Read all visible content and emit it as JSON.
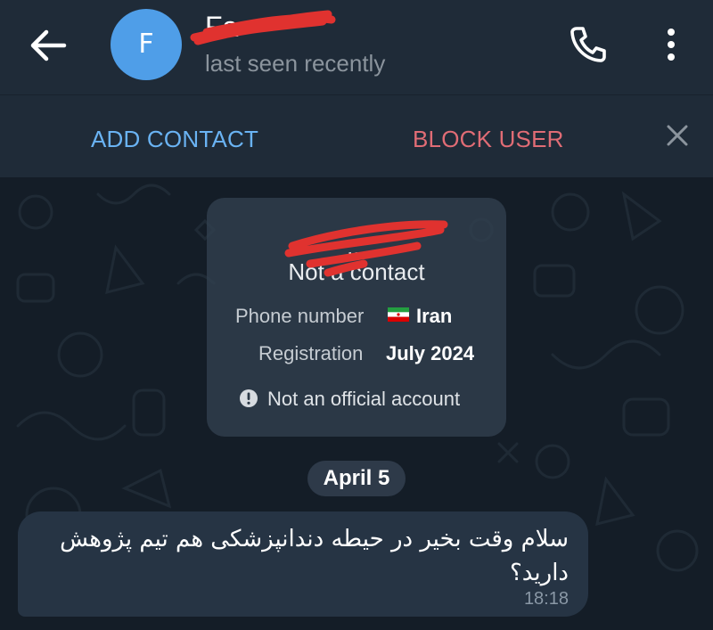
{
  "header": {
    "avatar_letter": "F",
    "contact_name": "Fa",
    "status": "last seen recently",
    "back_icon": "arrow-left-icon",
    "call_icon": "phone-icon",
    "menu_icon": "more-vertical-icon"
  },
  "actions": {
    "add_contact": "ADD CONTACT",
    "block_user": "BLOCK USER",
    "close_icon": "close-icon"
  },
  "info_card": {
    "name": "...",
    "subtitle": "Not a contact",
    "phone_label": "Phone number",
    "phone_value": "Iran",
    "flag_icon": "iran-flag-icon",
    "registration_label": "Registration",
    "registration_value": "July 2024",
    "warning_icon": "exclamation-circle-icon",
    "warning_text": "Not an official account"
  },
  "date_separator": "April 5",
  "message": {
    "text": "سلام وقت بخیر در حیطه دندانپزشکی هم تیم پژوهش دارید؟",
    "time": "18:18"
  },
  "colors": {
    "header_bg": "#1f2b38",
    "chat_bg": "#141d27",
    "accent_blue": "#6ab3f3",
    "danger_red": "#e06c75",
    "avatar_bg": "#4f9ee8",
    "redaction": "#e0322f"
  }
}
